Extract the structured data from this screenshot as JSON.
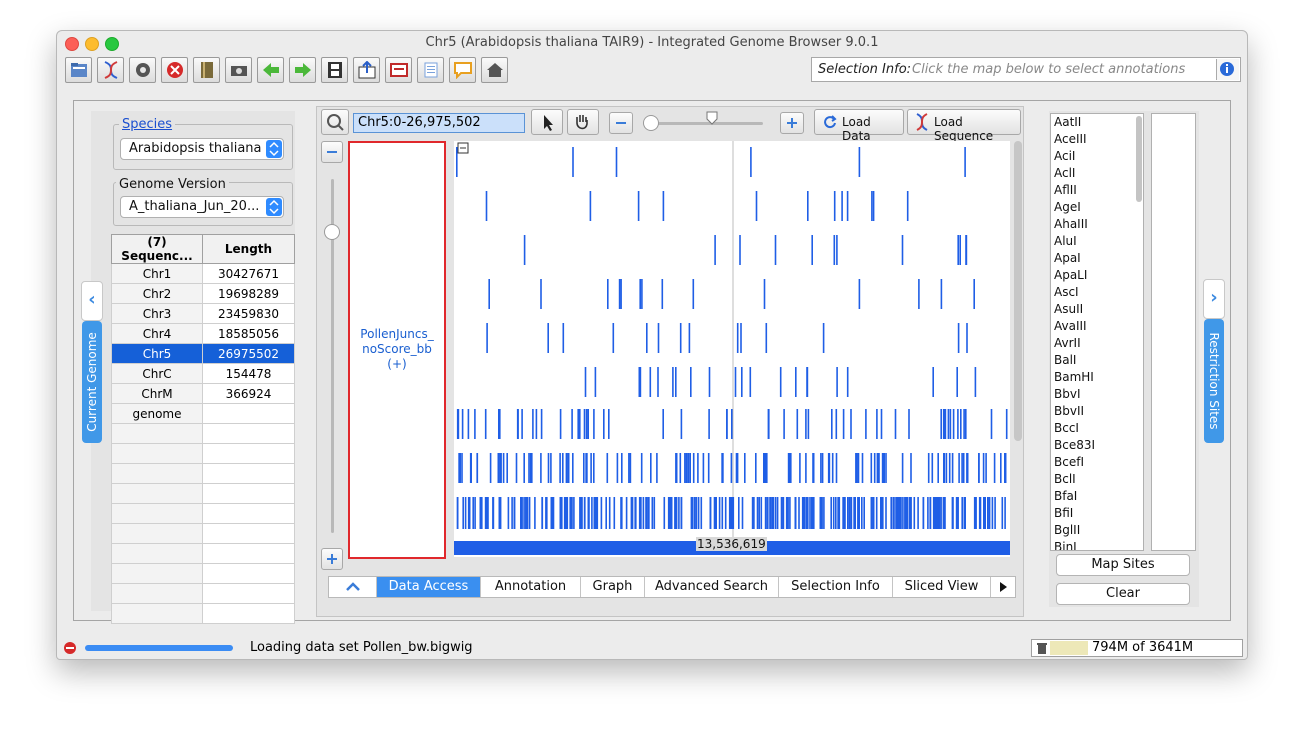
{
  "window": {
    "title": "Chr5  (Arabidopsis thaliana TAIR9) - Integrated Genome Browser 9.0.1"
  },
  "toolbar": {
    "icons": [
      "open-file-icon",
      "dna-icon",
      "gear-icon",
      "stop-icon",
      "bookmark-book-icon",
      "camera-icon",
      "back-arrow-icon",
      "forward-arrow-icon",
      "filmstrip-icon",
      "export-icon",
      "print-icon",
      "list-icon",
      "comment-icon",
      "home-icon"
    ]
  },
  "selection_info": {
    "label": "Selection Info:",
    "placeholder": "Click the map below to select annotations"
  },
  "left_panel": {
    "species_label": "Species",
    "species_value": "Arabidopsis thaliana",
    "genome_version_label": "Genome Version",
    "genome_version_value": "A_thaliana_Jun_20...",
    "table": {
      "headers": [
        "(7) Sequenc...",
        "Length"
      ],
      "rows": [
        {
          "name": "Chr1",
          "length": "30427671"
        },
        {
          "name": "Chr2",
          "length": "19698289"
        },
        {
          "name": "Chr3",
          "length": "23459830"
        },
        {
          "name": "Chr4",
          "length": "18585056"
        },
        {
          "name": "Chr5",
          "length": "26975502"
        },
        {
          "name": "ChrC",
          "length": "154478"
        },
        {
          "name": "ChrM",
          "length": "366924"
        },
        {
          "name": "genome",
          "length": ""
        }
      ],
      "selected_row": 4
    },
    "side_tab": "Current Genome"
  },
  "center": {
    "coordinates": "Chr5:0-26,975,502",
    "load_data_label": "Load Data",
    "load_sequence_label": "Load Sequence",
    "track_label_line1": "PollenJuncs_",
    "track_label_line2": "noScore_bb",
    "track_label_line3": "(+)",
    "coordinate_readout": "13,536,619",
    "tabs": [
      "Data Access",
      "Annotation",
      "Graph",
      "Advanced Search",
      "Selection Info",
      "Sliced View"
    ],
    "active_tab": "Data Access"
  },
  "right_panel": {
    "side_tab": "Restriction Sites",
    "enzymes": [
      "AatII",
      "AceIII",
      "AciI",
      "AclI",
      "AflII",
      "AgeI",
      "AhaIII",
      "AluI",
      "ApaI",
      "ApaLI",
      "AscI",
      "AsuII",
      "AvaIII",
      "AvrII",
      "BalI",
      "BamHI",
      "BbvI",
      "BbvII",
      "BccI",
      "Bce83I",
      "BcefI",
      "BclI",
      "BfaI",
      "BfiI",
      "BglII",
      "BinI"
    ],
    "map_sites_label": "Map Sites",
    "clear_label": "Clear"
  },
  "status_bar": {
    "message": "Loading data set Pollen_bw.bigwig",
    "memory": "794M of 3641M"
  },
  "colors": {
    "accent": "#3a8ff0",
    "feature": "#1f5ee6",
    "selection": "#1560d8",
    "label_border": "#e0282c"
  }
}
